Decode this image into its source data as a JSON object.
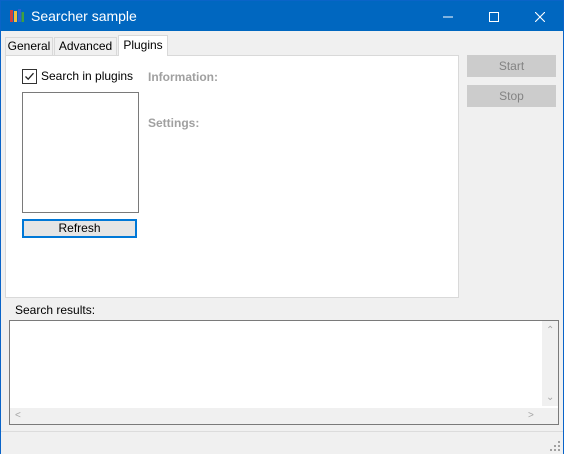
{
  "window": {
    "title": "Searcher sample"
  },
  "tabs": [
    {
      "label": "General"
    },
    {
      "label": "Advanced"
    },
    {
      "label": "Plugins"
    }
  ],
  "plugins": {
    "checkbox_label": "Search in plugins",
    "checked": true,
    "refresh_label": "Refresh",
    "information_label": "Information:",
    "settings_label": "Settings:"
  },
  "actions": {
    "start_label": "Start",
    "stop_label": "Stop"
  },
  "results": {
    "label": "Search results:"
  },
  "icons": {
    "app": "books-icon",
    "minimize": "minimize-icon",
    "maximize": "maximize-icon",
    "close": "close-icon",
    "check": "checkmark-icon",
    "grip": "resize-grip-icon"
  },
  "colors": {
    "titlebar": "#0067c0",
    "disabled_text": "#a0a0a0",
    "focus_border": "#0078d7"
  }
}
